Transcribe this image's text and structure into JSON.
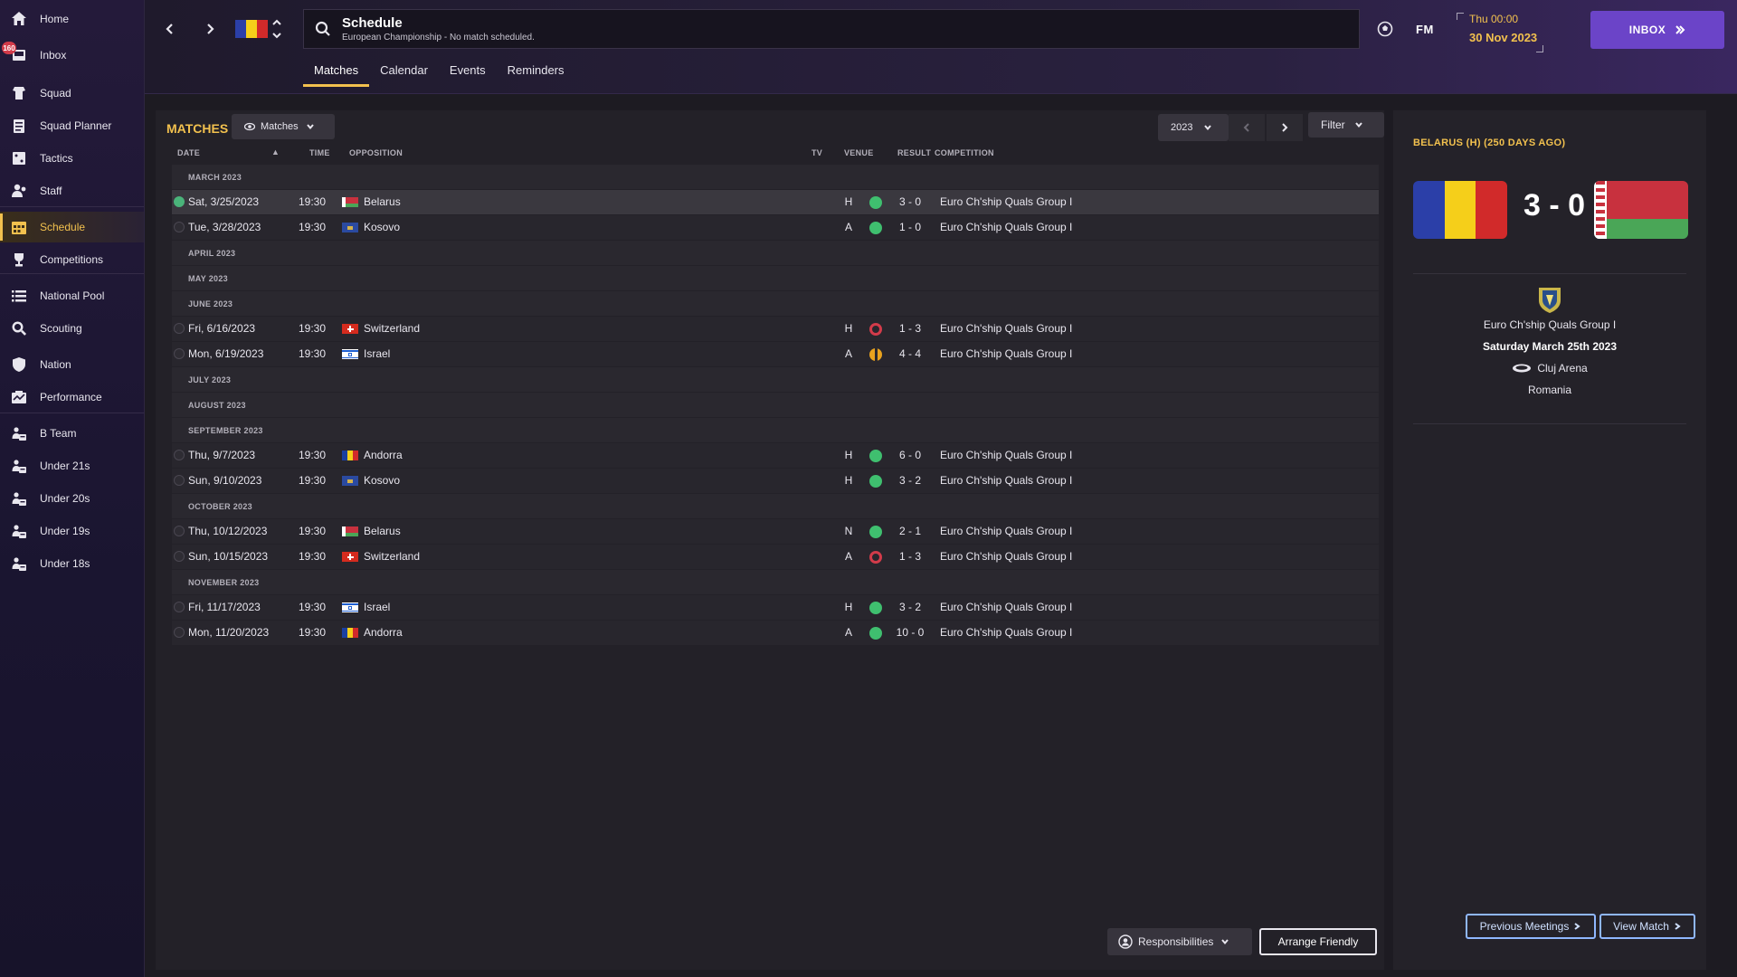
{
  "sidebar": {
    "badge_count": "160",
    "items": [
      {
        "label": "Home",
        "icon": "home-icon"
      },
      {
        "label": "Inbox",
        "icon": "inbox-icon"
      },
      {
        "label": "Squad",
        "icon": "squad-icon"
      },
      {
        "label": "Squad Planner",
        "icon": "clipboard-icon"
      },
      {
        "label": "Tactics",
        "icon": "tactics-icon"
      },
      {
        "label": "Staff",
        "icon": "staff-icon"
      },
      {
        "label": "Schedule",
        "icon": "calendar-icon"
      },
      {
        "label": "Competitions",
        "icon": "trophy-icon"
      },
      {
        "label": "National Pool",
        "icon": "list-icon"
      },
      {
        "label": "Scouting",
        "icon": "search-icon"
      },
      {
        "label": "Nation",
        "icon": "shield-icon"
      },
      {
        "label": "Performance",
        "icon": "performance-icon"
      },
      {
        "label": "B Team",
        "icon": "team-icon"
      },
      {
        "label": "Under 21s",
        "icon": "team-icon"
      },
      {
        "label": "Under 20s",
        "icon": "team-icon"
      },
      {
        "label": "Under 19s",
        "icon": "team-icon"
      },
      {
        "label": "Under 18s",
        "icon": "team-icon"
      }
    ]
  },
  "header": {
    "title": "Schedule",
    "subtitle": "European Championship - No match scheduled.",
    "fm_label": "FM",
    "time": "Thu 00:00",
    "date": "30 Nov 2023",
    "inbox_label": "INBOX"
  },
  "tabs": [
    "Matches",
    "Calendar",
    "Events",
    "Reminders"
  ],
  "main": {
    "section_title": "MATCHES",
    "view_label": "Matches",
    "year": "2023",
    "filter_label": "Filter",
    "columns": {
      "date": "DATE",
      "time": "TIME",
      "opposition": "OPPOSITION",
      "tv": "TV",
      "venue": "VENUE",
      "result": "RESULT",
      "competition": "COMPETITION"
    },
    "responsibilities_label": "Responsibilities",
    "arrange_label": "Arrange Friendly"
  },
  "rows": [
    {
      "type": "month",
      "label": "MARCH 2023"
    },
    {
      "type": "match",
      "date": "Sat, 3/25/2023",
      "time": "19:30",
      "opponent": "Belarus",
      "flag": "belarus",
      "venue": "H",
      "outcome": "win",
      "score": "3 - 0",
      "competition": "Euro Ch'ship Quals Group I",
      "selected": true,
      "checked": true
    },
    {
      "type": "match",
      "date": "Tue, 3/28/2023",
      "time": "19:30",
      "opponent": "Kosovo",
      "flag": "kosovo",
      "venue": "A",
      "outcome": "win",
      "score": "1 - 0",
      "competition": "Euro Ch'ship Quals Group I"
    },
    {
      "type": "month",
      "label": "APRIL 2023"
    },
    {
      "type": "month",
      "label": "MAY 2023"
    },
    {
      "type": "month",
      "label": "JUNE 2023"
    },
    {
      "type": "match",
      "date": "Fri, 6/16/2023",
      "time": "19:30",
      "opponent": "Switzerland",
      "flag": "switzerland",
      "venue": "H",
      "outcome": "loss",
      "score": "1 - 3",
      "competition": "Euro Ch'ship Quals Group I"
    },
    {
      "type": "match",
      "date": "Mon, 6/19/2023",
      "time": "19:30",
      "opponent": "Israel",
      "flag": "israel",
      "venue": "A",
      "outcome": "draw",
      "score": "4 - 4",
      "competition": "Euro Ch'ship Quals Group I"
    },
    {
      "type": "month",
      "label": "JULY 2023"
    },
    {
      "type": "month",
      "label": "AUGUST 2023"
    },
    {
      "type": "month",
      "label": "SEPTEMBER 2023"
    },
    {
      "type": "match",
      "date": "Thu, 9/7/2023",
      "time": "19:30",
      "opponent": "Andorra",
      "flag": "andorra",
      "venue": "H",
      "outcome": "win",
      "score": "6 - 0",
      "competition": "Euro Ch'ship Quals Group I"
    },
    {
      "type": "match",
      "date": "Sun, 9/10/2023",
      "time": "19:30",
      "opponent": "Kosovo",
      "flag": "kosovo",
      "venue": "H",
      "outcome": "win",
      "score": "3 - 2",
      "competition": "Euro Ch'ship Quals Group I"
    },
    {
      "type": "month",
      "label": "OCTOBER 2023"
    },
    {
      "type": "match",
      "date": "Thu, 10/12/2023",
      "time": "19:30",
      "opponent": "Belarus",
      "flag": "belarus",
      "venue": "N",
      "outcome": "win",
      "score": "2 - 1",
      "competition": "Euro Ch'ship Quals Group I"
    },
    {
      "type": "match",
      "date": "Sun, 10/15/2023",
      "time": "19:30",
      "opponent": "Switzerland",
      "flag": "switzerland",
      "venue": "A",
      "outcome": "loss",
      "score": "1 - 3",
      "competition": "Euro Ch'ship Quals Group I"
    },
    {
      "type": "month",
      "label": "NOVEMBER 2023"
    },
    {
      "type": "match",
      "date": "Fri, 11/17/2023",
      "time": "19:30",
      "opponent": "Israel",
      "flag": "israel",
      "venue": "H",
      "outcome": "win",
      "score": "3 - 2",
      "competition": "Euro Ch'ship Quals Group I"
    },
    {
      "type": "match",
      "date": "Mon, 11/20/2023",
      "time": "19:30",
      "opponent": "Andorra",
      "flag": "andorra",
      "venue": "A",
      "outcome": "win",
      "score": "10 - 0",
      "competition": "Euro Ch'ship Quals Group I"
    }
  ],
  "detail": {
    "title": "BELARUS (H) (250 DAYS AGO)",
    "score": "3 - 0",
    "competition": "Euro Ch'ship Quals Group I",
    "date": "Saturday March 25th 2023",
    "stadium": "Cluj Arena",
    "country": "Romania",
    "prev_meetings_label": "Previous Meetings",
    "view_match_label": "View Match"
  },
  "colors": {
    "accent": "#f2c14e",
    "inbox": "#6b44c8",
    "win": "#3fbf6f",
    "loss": "#d23b4a",
    "draw": "#e8a21e"
  }
}
